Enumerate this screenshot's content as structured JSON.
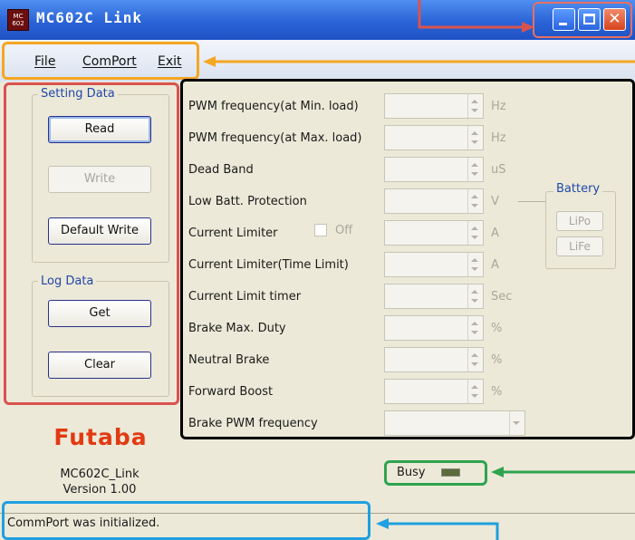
{
  "window": {
    "icon_text": "MC 602",
    "title": "MC602C Link"
  },
  "menu": {
    "file": "File",
    "comport": "ComPort",
    "exit": "Exit"
  },
  "setting_data": {
    "legend": "Setting Data",
    "read": "Read",
    "write": "Write",
    "default_write": "Default Write"
  },
  "log_data": {
    "legend": "Log Data",
    "get": "Get",
    "clear": "Clear"
  },
  "logo": {
    "brand": "Futaba",
    "app_name": "MC602C_Link",
    "version": "Version 1.00"
  },
  "params": [
    {
      "label": "PWM frequency(at Min. load)",
      "unit": "Hz"
    },
    {
      "label": "PWM frequency(at Max. load)",
      "unit": "Hz"
    },
    {
      "label": "Dead Band",
      "unit": "uS"
    },
    {
      "label": "Low Batt. Protection",
      "unit": "V"
    },
    {
      "label": "Current Limiter",
      "unit": "A"
    },
    {
      "label": "Current Limiter(Time Limit)",
      "unit": "A"
    },
    {
      "label": "Current Limit timer",
      "unit": "Sec"
    },
    {
      "label": "Brake Max. Duty",
      "unit": "%"
    },
    {
      "label": "Neutral Brake",
      "unit": "%"
    },
    {
      "label": "Forward Boost",
      "unit": "%"
    },
    {
      "label": "Brake PWM frequency",
      "unit": ""
    }
  ],
  "current_limiter_checkbox": "Off",
  "battery": {
    "legend": "Battery",
    "lipo": "LiPo",
    "life": "LiFe"
  },
  "busy": {
    "label": "Busy",
    "indicator_color": "#5a6b3c"
  },
  "status": {
    "text": "CommPort was initialized."
  },
  "colors": {
    "annotation_red": "#d9534f",
    "annotation_orange": "#f5a623",
    "annotation_green": "#2ea44f",
    "annotation_blue": "#1fa0e0",
    "annotation_black": "#000000"
  }
}
